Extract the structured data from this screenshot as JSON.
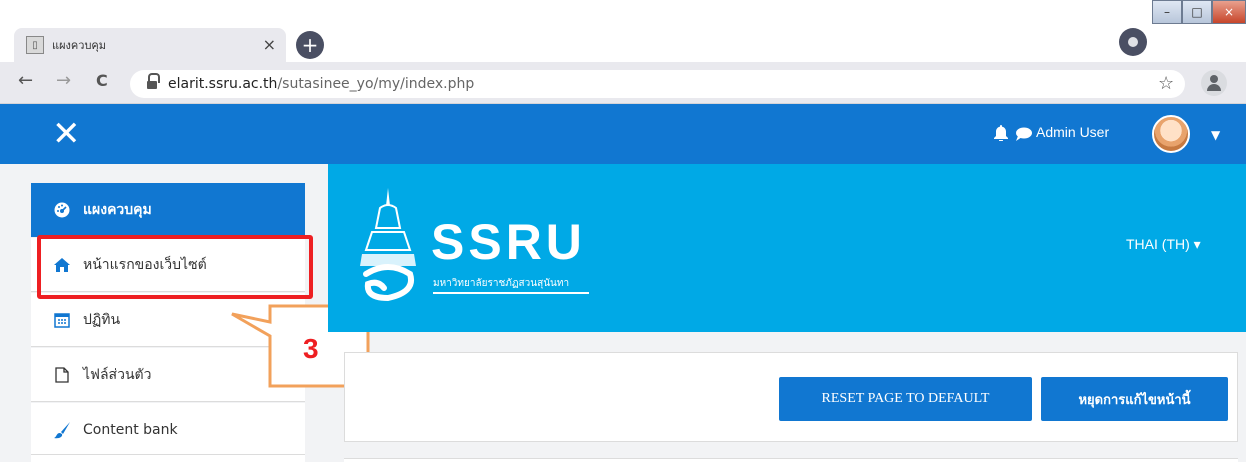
{
  "browser": {
    "tab_title": "แผงควบคุม",
    "tab_close": "×",
    "new_tab": "+",
    "url_host": "elarit.ssru.ac.th",
    "url_path": "/sutasinee_yo/my/index.php",
    "back": "←",
    "forward": "→",
    "reload": "C",
    "star": "☆",
    "win_min": "–",
    "win_max": "□",
    "win_close": "×"
  },
  "navbar": {
    "close_glyph": "✕",
    "user_name": "Admin User",
    "caret": "▼"
  },
  "drawer": {
    "items": [
      {
        "label": "แผงควบคุม",
        "icon": "dashboard-icon",
        "active": true
      },
      {
        "label": "หน้าแรกของเว็บไซต์",
        "icon": "home-icon"
      },
      {
        "label": "ปฏิทิน",
        "icon": "calendar-icon"
      },
      {
        "label": "ไฟล์ส่วนตัว",
        "icon": "file-icon"
      },
      {
        "label": "Content bank",
        "icon": "paintbrush-icon"
      }
    ]
  },
  "annotation": {
    "number": "3"
  },
  "banner": {
    "logo_text": "SSRU",
    "logo_subtitle": "มหาวิทยาลัยราชภัฏสวนสุนันทา",
    "language": "THAI (TH) ▾"
  },
  "actions": {
    "reset_label": "RESET PAGE TO DEFAULT",
    "stop_edit_label": "หยุดการแก้ไขหน้านี้"
  },
  "colors": {
    "navbar": "#1177d1",
    "banner": "#00a9e6",
    "highlight": "#ee1f22",
    "callout_border": "#f2a15b"
  }
}
